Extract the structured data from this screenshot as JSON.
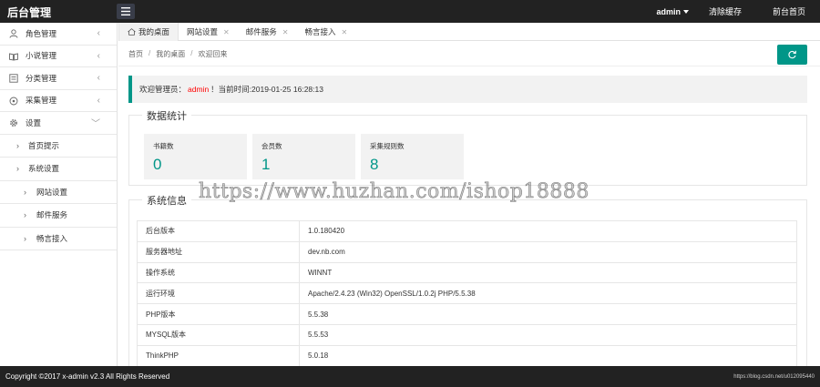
{
  "header": {
    "brand": "后台管理",
    "user": "admin",
    "clear_cache": "清除缓存",
    "front_home": "前台首页"
  },
  "sidebar": {
    "items": [
      {
        "label": "角色管理",
        "icon": "user-icon",
        "arrow": "‹"
      },
      {
        "label": "小说管理",
        "icon": "book-icon",
        "arrow": "‹"
      },
      {
        "label": "分类管理",
        "icon": "category-icon",
        "arrow": "‹"
      },
      {
        "label": "采集管理",
        "icon": "collect-icon",
        "arrow": "‹"
      },
      {
        "label": "设置",
        "icon": "gear-icon",
        "arrow": "﹀"
      }
    ],
    "sub": [
      {
        "label": "首页提示"
      },
      {
        "label": "系统设置"
      }
    ],
    "sub2": [
      {
        "label": "网站设置"
      },
      {
        "label": "邮件服务"
      },
      {
        "label": "畅言接入"
      }
    ]
  },
  "tabs": [
    {
      "label": "我的桌面"
    },
    {
      "label": "网站设置"
    },
    {
      "label": "邮件服务"
    },
    {
      "label": "畅言接入"
    }
  ],
  "breadcrumb": [
    "首页",
    "我的桌面",
    "欢迎回来"
  ],
  "welcome": {
    "prefix": "欢迎管理员：",
    "user": "admin",
    "suffix": "！当前时间:2019-01-25 16:28:13"
  },
  "stats": {
    "title": "数据统计",
    "items": [
      {
        "label": "书籍数",
        "value": "0"
      },
      {
        "label": "会员数",
        "value": "1"
      },
      {
        "label": "采集规则数",
        "value": "8"
      }
    ]
  },
  "sysinfo": {
    "title": "系统信息",
    "rows": [
      [
        "后台版本",
        "1.0.180420"
      ],
      [
        "服务器地址",
        "dev.nb.com"
      ],
      [
        "操作系统",
        "WINNT"
      ],
      [
        "运行环境",
        "Apache/2.4.23 (Win32) OpenSSL/1.0.2j PHP/5.5.38"
      ],
      [
        "PHP版本",
        "5.5.38"
      ],
      [
        "MYSQL版本",
        "5.5.53"
      ],
      [
        "ThinkPHP",
        "5.0.18"
      ]
    ]
  },
  "watermark": "https://www.huzhan.com/ishop18888",
  "footer": {
    "copyright": "Copyright ©2017 x-admin v2.3 All Rights Reserved",
    "source": "https://blog.csdn.net/u012095440"
  },
  "colors": {
    "accent": "#009688",
    "dark": "#222222",
    "highlight": "#ff0000"
  }
}
